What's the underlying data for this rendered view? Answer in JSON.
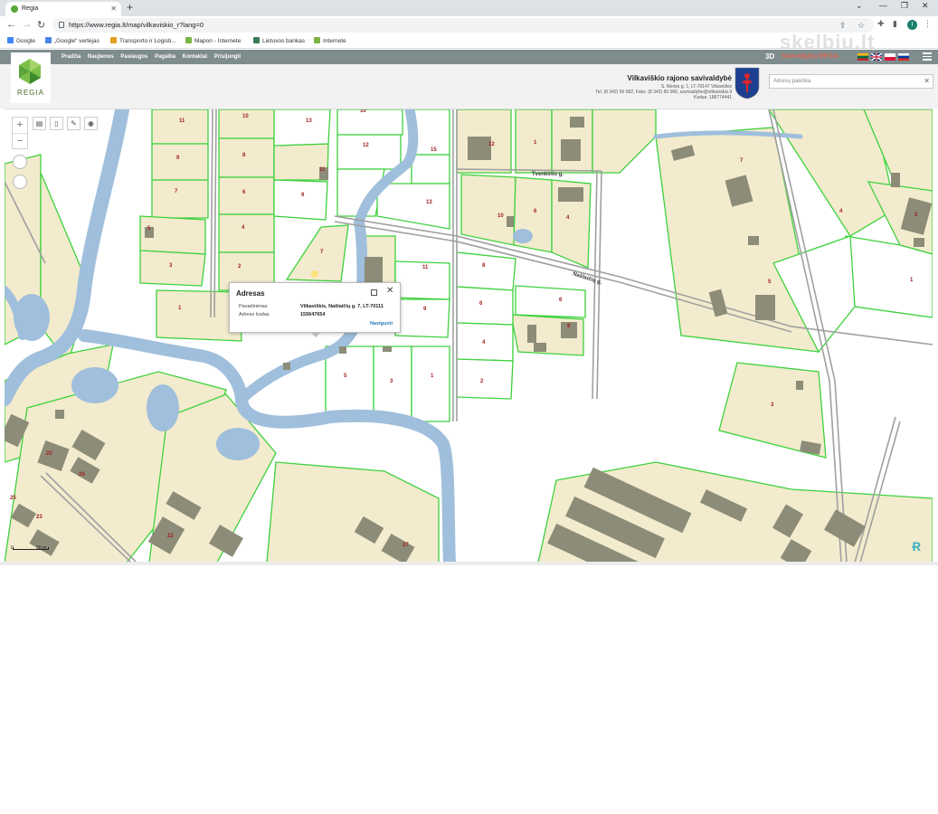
{
  "browser": {
    "tab_title": "Regia",
    "url": "https://www.regia.lt/map/vilkaviskio_r?lang=0",
    "new_tab": "+",
    "bookmarks": [
      {
        "label": "Google",
        "color": "#4285f4"
      },
      {
        "label": "„Google“ vertėjas",
        "color": "#4a86e8"
      },
      {
        "label": "Transporto ir Logisti...",
        "color": "#e0a020"
      },
      {
        "label": "Mapon - Internete",
        "color": "#7cb342"
      },
      {
        "label": "Lietuvos bankas",
        "color": "#3b7a57"
      },
      {
        "label": "Internete",
        "color": "#7cb342"
      }
    ],
    "profile_initial": "I"
  },
  "app": {
    "logo_text": "REGIA",
    "menu": [
      "Pradžia",
      "Naujienos",
      "Paslaugos",
      "Pagalba",
      "Kontaktai",
      "Prisijungti"
    ],
    "btn_3d": "3D",
    "savivaldybiu": "Savivaldybių REGIA",
    "muni_name": "Vilkaviškio rajono savivaldybė",
    "muni_address": "S. Nėries g. 1, LT-70147 Vilkaviškis",
    "muni_contacts": "Tel. (8 342) 60 082, Faks. (8 342) 60 066, savivaldybe@vilkaviskis.lt",
    "muni_code": "Kodas: 188774441",
    "search_placeholder": "Adresų paieška"
  },
  "map": {
    "colors": {
      "parcel_fill": "#f3ebcd",
      "parcel_stroke": "#3dd13d",
      "water": "#9fbfdc",
      "building": "#8c8c78",
      "road": "#a0a0a0"
    },
    "street_labels": [
      "Tvenkinio g.",
      "Našlaičių g."
    ],
    "parcel_numbers": [
      "11",
      "9",
      "7",
      "5",
      "3",
      "1",
      "10",
      "8",
      "6",
      "4",
      "2",
      "13",
      "11",
      "9",
      "7",
      "12",
      "10",
      "15",
      "13",
      "11",
      "9",
      "5",
      "3",
      "1",
      "8",
      "6",
      "4",
      "2",
      "12",
      "1",
      "10",
      "6",
      "4",
      "6",
      "8",
      "7",
      "5",
      "3",
      "4",
      "3",
      "1",
      "20",
      "24",
      "25",
      "23",
      "22",
      "27"
    ],
    "scale_left": "0",
    "scale_right": "20 m"
  },
  "popup": {
    "title": "Adresas",
    "rows": [
      {
        "key": "Pavadinimas",
        "value": "Vilkaviškis, Našlaičių g. 7, LT-70111"
      },
      {
        "key": "Adreso kodas",
        "value": "155647654"
      }
    ],
    "link": "Naviguoti"
  },
  "watermark": "skelbiu.lt"
}
